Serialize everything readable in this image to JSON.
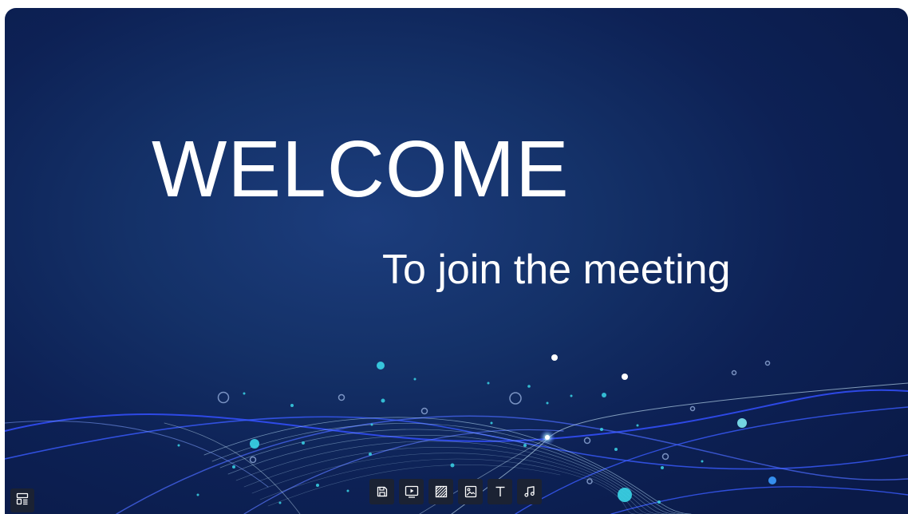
{
  "slide": {
    "title": "WELCOME",
    "subtitle": "To join the meeting"
  },
  "colors": {
    "background_center": "#1c3d7d",
    "background_edge": "#0a1a48",
    "wave_blue": "#3a5bff",
    "wave_light": "#bfe6ff",
    "particle_cyan": "#3ad6e8",
    "toolbar_bg": "#1b2233",
    "icon": "#ffffff"
  },
  "layout_button": {
    "icon": "layout-list-icon"
  },
  "toolbar": {
    "buttons": [
      {
        "icon": "save-icon"
      },
      {
        "icon": "play-video-icon"
      },
      {
        "icon": "background-pattern-icon"
      },
      {
        "icon": "image-icon"
      },
      {
        "icon": "text-icon"
      },
      {
        "icon": "music-icon"
      }
    ]
  }
}
